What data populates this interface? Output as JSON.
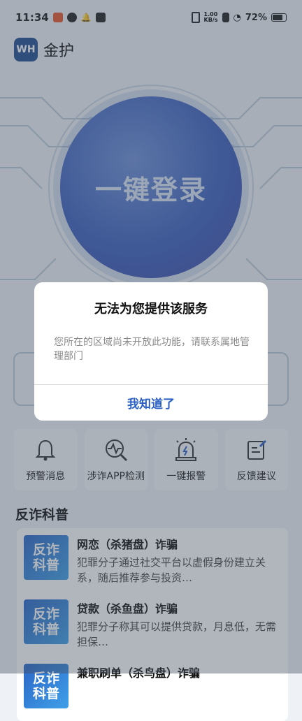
{
  "status_bar": {
    "time": "11:34",
    "net_speed": "1.00\nKB/s",
    "battery": "72%"
  },
  "header": {
    "logo_text": "WH",
    "app_name": "金护"
  },
  "hero": {
    "login_button": "一键登录"
  },
  "actions": [
    {
      "label": "预警消息",
      "icon": "bell-icon"
    },
    {
      "label": "涉诈APP检测",
      "icon": "scan-icon"
    },
    {
      "label": "一键报警",
      "icon": "alarm-icon"
    },
    {
      "label": "反馈建议",
      "icon": "feedback-icon"
    }
  ],
  "section": {
    "title": "反诈科普",
    "thumb_line1": "反诈",
    "thumb_line2": "科普",
    "cards": [
      {
        "title": "网恋（杀猪盘）诈骗",
        "desc": "犯罪分子通过社交平台以虚假身份建立关系，随后推荐参与投资…"
      },
      {
        "title": "贷款（杀鱼盘）诈骗",
        "desc": "犯罪分子称其可以提供贷款，月息低，无需担保…"
      },
      {
        "title": "兼职刷单（杀鸟盘）诈骗",
        "desc": ""
      }
    ]
  },
  "dialog": {
    "title": "无法为您提供该服务",
    "message": "您所在的区域尚未开放此功能，请联系属地管理部门",
    "button": "我知道了"
  },
  "colors": {
    "accent": "#2a5fc4",
    "brand": "#1f4d8f"
  }
}
